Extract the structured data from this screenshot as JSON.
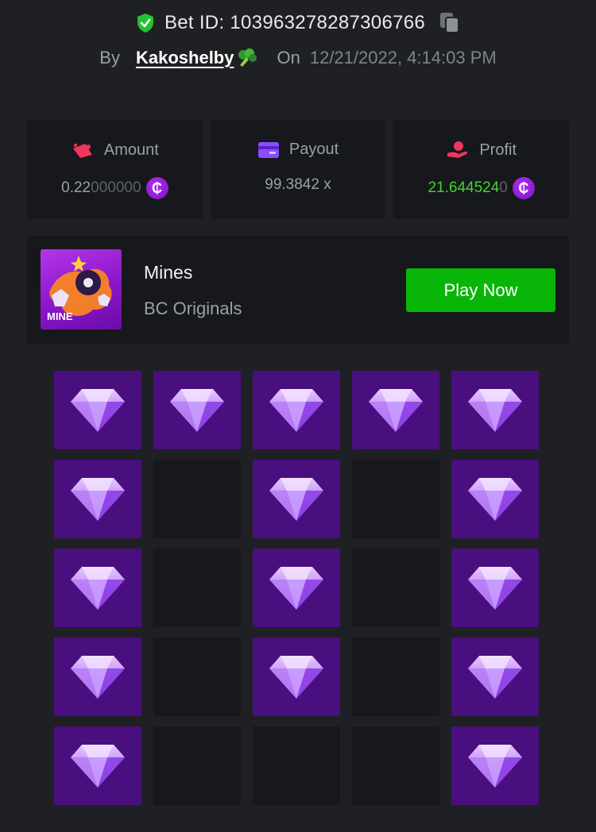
{
  "header": {
    "bet_id_label": "Bet ID: 103963278287306766",
    "by_label": "By",
    "username": "Kakoshelby",
    "on_label": "On",
    "datetime": "12/21/2022, 4:14:03 PM"
  },
  "stats": {
    "amount": {
      "label": "Amount",
      "value_main": "0.22",
      "value_dim": "000000",
      "currency_symbol": "₵"
    },
    "payout": {
      "label": "Payout",
      "value": "99.3842 x"
    },
    "profit": {
      "label": "Profit",
      "value_main": "21.644524",
      "value_dim": "0",
      "currency_symbol": "₵"
    }
  },
  "game": {
    "thumb_label": "MINE",
    "name": "Mines",
    "provider": "BC Originals",
    "play_label": "Play Now"
  },
  "colors": {
    "background": "#1f2023",
    "card": "#17181b",
    "gem_tile": "#4a0f7e",
    "accent_green": "#08b508",
    "profit_green": "#3dd62c",
    "coin_purple": "#9b1fe0"
  },
  "icons": {
    "bet_id": "shield-check-icon",
    "copy": "copy-icon",
    "amount": "wallet-icon",
    "payout": "card-icon",
    "profit": "hand-coin-icon",
    "currency": "coin-icon",
    "gem": "diamond-icon"
  },
  "grid": {
    "rows": 5,
    "cols": 5,
    "tiles": [
      "gem",
      "gem",
      "gem",
      "gem",
      "gem",
      "gem",
      "empty",
      "gem",
      "empty",
      "gem",
      "gem",
      "empty",
      "gem",
      "empty",
      "gem",
      "gem",
      "empty",
      "gem",
      "empty",
      "gem",
      "gem",
      "empty",
      "empty",
      "empty",
      "gem"
    ]
  }
}
